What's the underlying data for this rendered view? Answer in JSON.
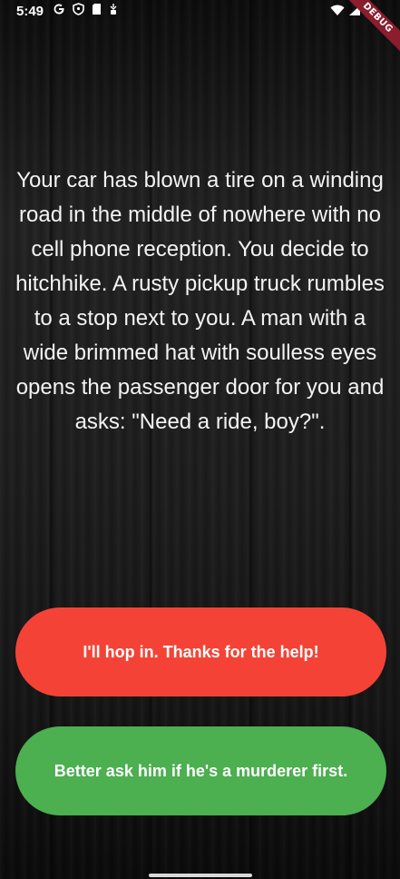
{
  "status_bar": {
    "time": "5:49",
    "icons_left": [
      "google-icon",
      "shield-icon",
      "sd-card-icon",
      "battery-saver-icon"
    ],
    "icons_right": [
      "wifi-icon",
      "signal-icon",
      "battery-icon"
    ]
  },
  "debug_banner": "DEBUG",
  "story": {
    "text": "Your car has blown a tire on a winding road in the middle of nowhere with no cell phone reception. You decide to hitchhike. A rusty pickup truck rumbles to a stop next to you. A man with a wide brimmed hat with soulless eyes opens the passenger door for you and asks: \"Need a ride, boy?\"."
  },
  "choices": [
    {
      "label": "I'll hop in. Thanks for the help!",
      "color": "#f44336"
    },
    {
      "label": "Better ask him if he's a murderer first.",
      "color": "#4caf50"
    }
  ]
}
